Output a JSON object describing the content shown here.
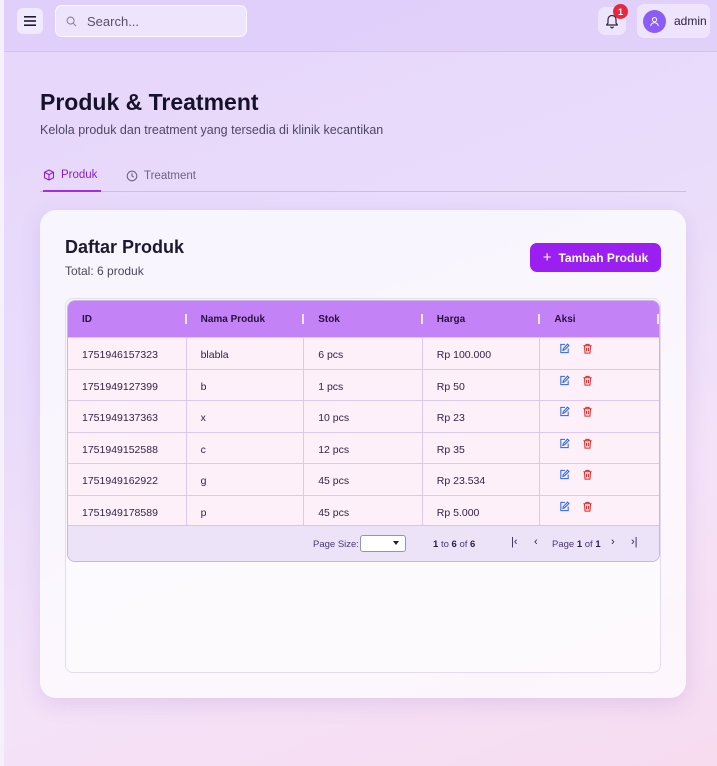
{
  "topbar": {
    "search_placeholder": "Search...",
    "notification_count": "1",
    "user_name": "admin"
  },
  "header": {
    "title": "Produk & Treatment",
    "subtitle": "Kelola produk dan treatment yang tersedia di klinik kecantikan"
  },
  "tabs": [
    {
      "label": "Produk",
      "active": true,
      "icon": "box-icon"
    },
    {
      "label": "Treatment",
      "active": false,
      "icon": "clock-icon"
    }
  ],
  "card": {
    "title": "Daftar Produk",
    "subtitle": "Total: 6 produk",
    "add_button": "Tambah Produk"
  },
  "table": {
    "columns": [
      "ID",
      "Nama Produk",
      "Stok",
      "Harga",
      "Aksi"
    ],
    "rows": [
      {
        "id": "1751946157323",
        "name": "blabla",
        "stok": "6 pcs",
        "harga": "Rp 100.000"
      },
      {
        "id": "1751949127399",
        "name": "b",
        "stok": "1 pcs",
        "harga": "Rp 50"
      },
      {
        "id": "1751949137363",
        "name": "x",
        "stok": "10 pcs",
        "harga": "Rp 23"
      },
      {
        "id": "1751949152588",
        "name": "c",
        "stok": "12 pcs",
        "harga": "Rp 35"
      },
      {
        "id": "1751949162922",
        "name": "g",
        "stok": "45 pcs",
        "harga": "Rp 23.534"
      },
      {
        "id": "1751949178589",
        "name": "p",
        "stok": "45 pcs",
        "harga": "Rp 5.000"
      }
    ]
  },
  "pager": {
    "page_size_label": "Page Size:",
    "range_from": "1",
    "range_to": "6",
    "range_total": "6",
    "to_word": "to",
    "of_word": "of",
    "page_word": "Page",
    "page_current": "1",
    "page_total": "1"
  },
  "colors": {
    "accent": "#9b1ff0",
    "header_bg": "#c382f5",
    "edit_icon": "#2563eb",
    "delete_icon": "#dc2626",
    "badge": "#e8273c"
  }
}
